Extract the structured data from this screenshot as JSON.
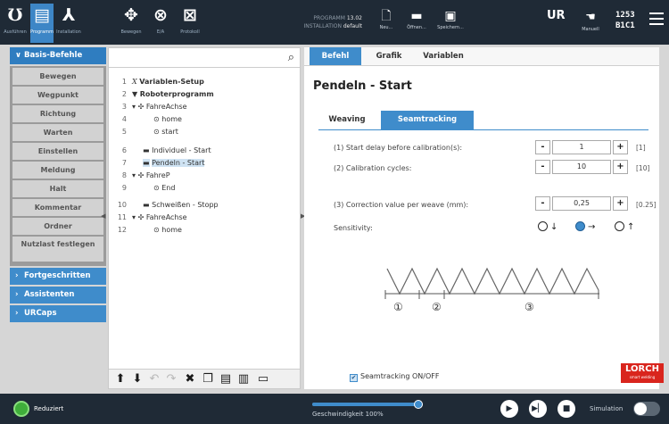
{
  "topbar": {
    "buttons": [
      {
        "name": "ausfuehren",
        "label": "Ausführen",
        "icon": "run-icon"
      },
      {
        "name": "programm",
        "label": "Programm",
        "icon": "program-icon"
      },
      {
        "name": "installation",
        "label": "Installation",
        "icon": "installation-icon"
      },
      {
        "name": "bewegen",
        "label": "Bewegen",
        "icon": "move-icon"
      },
      {
        "name": "e-a",
        "label": "E/A",
        "icon": "io-icon"
      },
      {
        "name": "protokoll",
        "label": "Protokoll",
        "icon": "log-icon"
      }
    ],
    "programm_label": "PROGRAMM",
    "programm_value": "13.02",
    "installation_label": "INSTALLATION",
    "installation_value": "default",
    "file_buttons": [
      {
        "name": "neu",
        "label": "Neu..."
      },
      {
        "name": "oeffnen",
        "label": "Öffnen..."
      },
      {
        "name": "speichern",
        "label": "Speichern..."
      }
    ],
    "manual_label": "Manuell",
    "counter_line1": "1253",
    "counter_line2": "B1C1",
    "active_color": "#3d86c6"
  },
  "sidebar": {
    "basis": "Basis-Befehle",
    "commands": [
      "Bewegen",
      "Wegpunkt",
      "Richtung",
      "Warten",
      "Einstellen",
      "Meldung",
      "Halt",
      "Kommentar",
      "Ordner",
      "Nutzlast festlegen"
    ],
    "categories": [
      "Fortgeschritten",
      "Assistenten",
      "URCaps"
    ]
  },
  "tree": {
    "rows": [
      {
        "num": "1",
        "text": "Variablen-Setup"
      },
      {
        "num": "2",
        "text": "Roboterprogramm"
      },
      {
        "num": "3",
        "text": "FahreAchse"
      },
      {
        "num": "4",
        "text": "home"
      },
      {
        "num": "5",
        "text": "start"
      },
      {
        "num": "6",
        "text": "Individuel - Start"
      },
      {
        "num": "7",
        "text": "Pendeln - Start"
      },
      {
        "num": "8",
        "text": "FahreP"
      },
      {
        "num": "9",
        "text": "End"
      },
      {
        "num": "10",
        "text": "Schweißen - Stopp"
      },
      {
        "num": "11",
        "text": "FahreAchse"
      },
      {
        "num": "12",
        "text": "home"
      }
    ]
  },
  "content": {
    "tabs": [
      "Befehl",
      "Grafik",
      "Variablen"
    ],
    "title": "Pendeln - Start",
    "subtabs": [
      "Weaving",
      "Seamtracking"
    ],
    "params": [
      {
        "label": "(1) Start delay before calibration(s):",
        "value": "1",
        "default": "[1]"
      },
      {
        "label": "(2) Calibration cycles:",
        "value": "10",
        "default": "[10]"
      },
      {
        "label": "(3) Correction value per weave (mm):",
        "value": "0,25",
        "default": "[0.25]"
      }
    ],
    "minus": "-",
    "plus": "+",
    "sensitivity_label": "Sensitivity:",
    "sensitivity_options": [
      "↓",
      "→",
      "↑"
    ],
    "sensitivity_selected": 1,
    "diagram_markers": [
      "①",
      "②",
      "③"
    ],
    "checkbox_label": "Seamtracking ON/OFF",
    "checkbox_checked": true,
    "logo_text": "LORCH",
    "logo_sub": "smart welding",
    "logo_color": "#d9251d"
  },
  "bottombar": {
    "status": "Reduziert",
    "speed_label": "Geschwindigkeit 100%",
    "speed_fraction": 1.0,
    "controls": [
      "play-icon",
      "step-icon",
      "stop-icon"
    ],
    "simulation_label": "Simulation",
    "simulation_on": false
  }
}
